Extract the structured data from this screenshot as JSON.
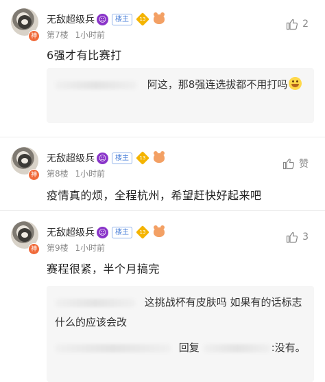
{
  "posts": [
    {
      "username": "无敌超级兵",
      "role_badge": "楼主",
      "level": "13",
      "floor": "第7楼",
      "time": "1小时前",
      "like_label": "2",
      "content": "6强才有比赛打",
      "replies": [
        {
          "text": "阿这，那8强连选拔都不用打吗",
          "trailing_emoji": "grin-emoji"
        }
      ]
    },
    {
      "username": "无敌超级兵",
      "role_badge": "楼主",
      "level": "13",
      "floor": "第8楼",
      "time": "1小时前",
      "like_label": "赞",
      "content": "疫情真的烦，全程杭州，希望赶快好起来吧",
      "replies": []
    },
    {
      "username": "无敌超级兵",
      "role_badge": "楼主",
      "level": "13",
      "floor": "第9楼",
      "time": "1小时前",
      "like_label": "3",
      "content": "赛程很紧，半个月搞完",
      "replies": [
        {
          "text": "这挑战杯有皮肤吗 如果有的话标志什么的应该会改"
        },
        {
          "prefix": "回复",
          "text": ":没有。"
        }
      ]
    }
  ],
  "avatar_badge": "神",
  "colors": {
    "accent": "#4a7fd8",
    "meta_text": "#8a8a8a",
    "reply_bg": "#f6f6f6",
    "devil": "#8a35c9",
    "level": "#f4b400"
  }
}
